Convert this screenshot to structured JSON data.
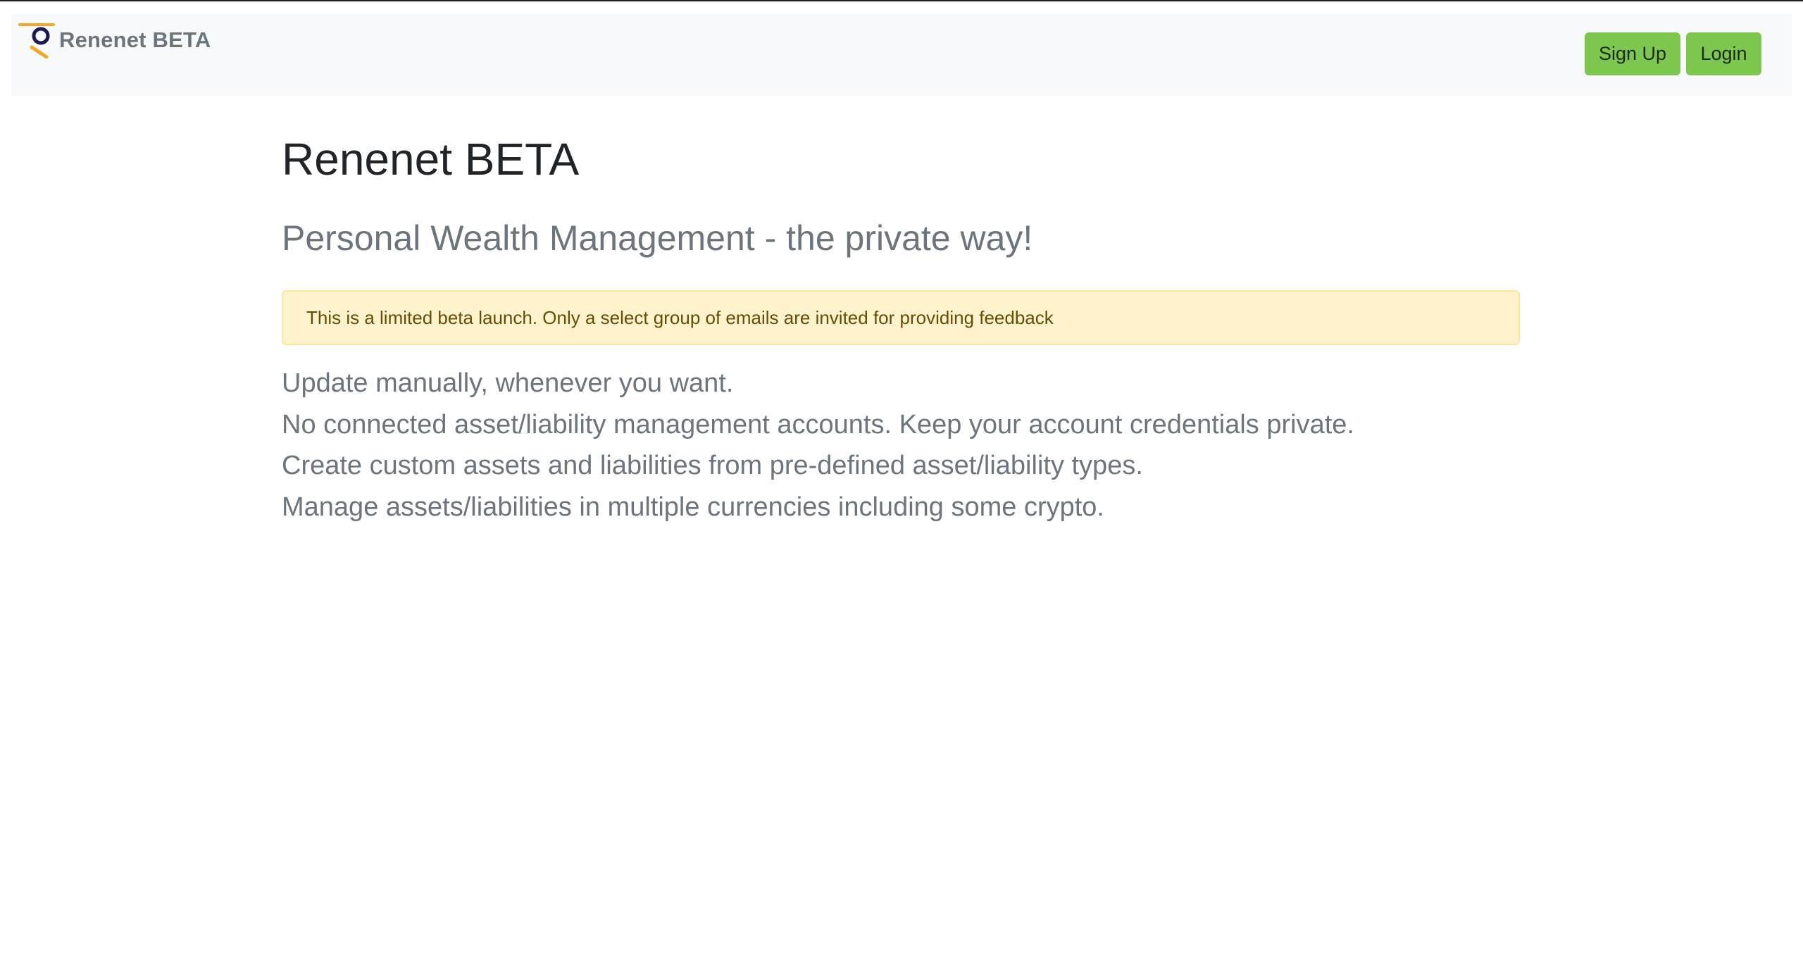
{
  "colors": {
    "navbar_bg": "#f8f9fa",
    "button_bg": "#7ec74f",
    "alert_bg": "#fff3cd",
    "alert_text": "#664d03",
    "muted_text": "#6c757d",
    "logo_orange": "#f5a623",
    "logo_navy": "#1b1a55"
  },
  "navbar": {
    "brand_logo": "renenet-logo-icon",
    "brand_name": "Renenet BETA",
    "signup_label": "Sign Up",
    "login_label": "Login"
  },
  "main": {
    "title": "Renenet BETA",
    "subtitle": "Personal Wealth Management - the private way!",
    "alert": "This is a limited beta launch. Only a select group of emails are invited for providing feedback",
    "features": [
      "Update manually, whenever you want.",
      "No connected asset/liability management accounts. Keep your account credentials private.",
      "Create custom assets and liabilities from pre-defined asset/liability types.",
      "Manage assets/liabilities in multiple currencies including some crypto."
    ]
  }
}
